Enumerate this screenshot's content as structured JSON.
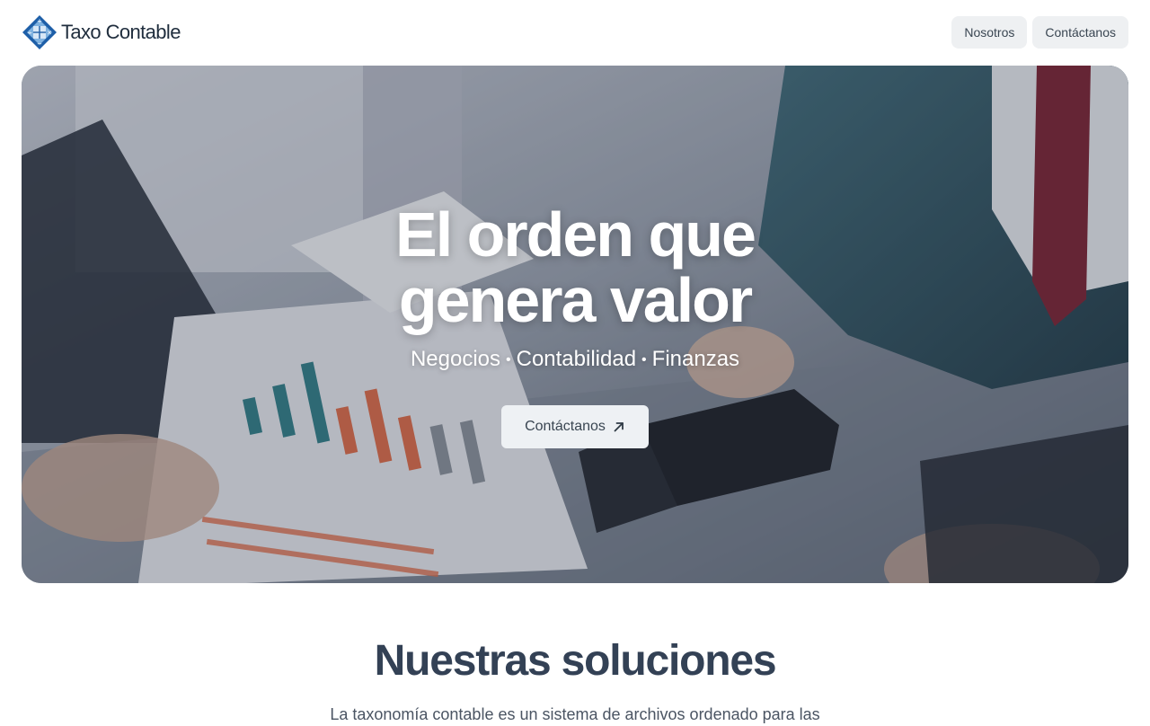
{
  "header": {
    "logo_text": "Taxo Contable",
    "nav": [
      {
        "label": "Nosotros"
      },
      {
        "label": "Contáctanos"
      }
    ]
  },
  "hero": {
    "title_line1": "El orden que",
    "title_line2": "genera valor",
    "subtitle_items": [
      "Negocios",
      "Contabilidad",
      "Finanzas"
    ],
    "cta_label": "Contáctanos",
    "cta_icon": "arrow-up-right-icon"
  },
  "solutions": {
    "title": "Nuestras soluciones",
    "text": "La taxonomía contable es un sistema de archivos ordenado para las"
  },
  "colors": {
    "heading": "#334155",
    "logo_blue": "#1e5fa8",
    "logo_light": "#7fb2e0",
    "button_bg": "#eef0f2"
  }
}
